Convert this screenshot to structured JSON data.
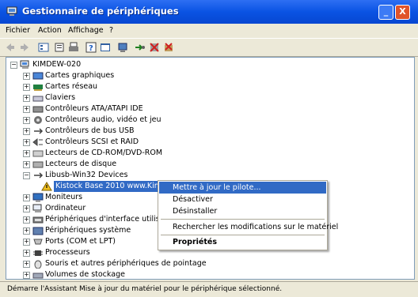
{
  "window": {
    "title": "Gestionnaire de périphériques",
    "minimize": "_",
    "close": "X"
  },
  "menu": [
    {
      "label": "Fichier"
    },
    {
      "label": "Action"
    },
    {
      "label": "Affichage"
    },
    {
      "label": "?"
    }
  ],
  "tree": {
    "root": "KIMDEW-020",
    "items": [
      {
        "label": "Cartes graphiques",
        "expander": "+",
        "icon": "display-adapter-icon"
      },
      {
        "label": "Cartes réseau",
        "expander": "+",
        "icon": "network-adapter-icon"
      },
      {
        "label": "Claviers",
        "expander": "+",
        "icon": "keyboard-icon"
      },
      {
        "label": "Contrôleurs ATA/ATAPI IDE",
        "expander": "+",
        "icon": "ide-controller-icon"
      },
      {
        "label": "Contrôleurs audio, vidéo et jeu",
        "expander": "+",
        "icon": "audio-icon"
      },
      {
        "label": "Contrôleurs de bus USB",
        "expander": "+",
        "icon": "usb-icon"
      },
      {
        "label": "Contrôleurs SCSI et RAID",
        "expander": "+",
        "icon": "scsi-icon"
      },
      {
        "label": "Lecteurs de CD-ROM/DVD-ROM",
        "expander": "+",
        "icon": "cdrom-icon"
      },
      {
        "label": "Lecteurs de disque",
        "expander": "+",
        "icon": "disk-drive-icon"
      },
      {
        "label": "Libusb-Win32 Devices",
        "expander": "−",
        "icon": "usb-icon"
      },
      {
        "label": "Kistock Base 2010 www.Kimo.fr",
        "child": true,
        "selected": true,
        "icon": "warning-device-icon"
      },
      {
        "label": "Moniteurs",
        "expander": "+",
        "icon": "monitor-icon"
      },
      {
        "label": "Ordinateur",
        "expander": "+",
        "icon": "computer-icon"
      },
      {
        "label": "Périphériques d'interface utilisateur",
        "expander": "+",
        "icon": "hid-icon"
      },
      {
        "label": "Périphériques système",
        "expander": "+",
        "icon": "system-device-icon"
      },
      {
        "label": "Ports (COM et LPT)",
        "expander": "+",
        "icon": "port-icon"
      },
      {
        "label": "Processeurs",
        "expander": "+",
        "icon": "processor-icon"
      },
      {
        "label": "Souris et autres périphériques de pointage",
        "expander": "+",
        "icon": "mouse-icon"
      },
      {
        "label": "Volumes de stockage",
        "expander": "+",
        "icon": "storage-volume-icon"
      }
    ]
  },
  "context_menu": {
    "items": [
      {
        "label": "Mettre à jour le pilote...",
        "highlighted": true
      },
      {
        "label": "Désactiver"
      },
      {
        "label": "Désinstaller"
      },
      {
        "label": "Rechercher les modifications sur le matériel"
      },
      {
        "label": "Propriétés",
        "bold": true
      }
    ]
  },
  "status": {
    "text": "Démarre l'Assistant Mise à jour du matériel pour le périphérique sélectionné."
  },
  "colors": {
    "title_bar": "#0a53e3",
    "selection": "#316ac5",
    "close_button": "#e0542b"
  },
  "toolbar_icons": [
    "back-icon",
    "forward-icon",
    "view-icon",
    "properties-icon",
    "print-icon",
    "help-icon",
    "console-icon",
    "scan-hardware-icon",
    "update-driver-icon",
    "disable-icon",
    "uninstall-icon"
  ]
}
